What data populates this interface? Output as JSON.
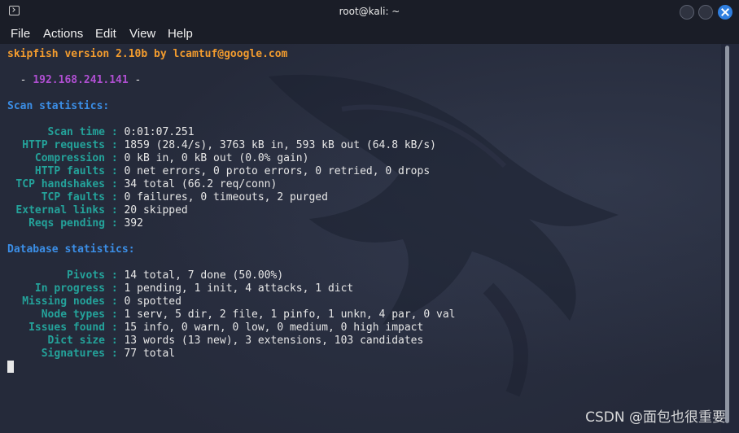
{
  "window": {
    "title": "root@kali: ~"
  },
  "menu": {
    "items": [
      "File",
      "Actions",
      "Edit",
      "View",
      "Help"
    ]
  },
  "terminal": {
    "banner": "skipfish version 2.10b by lcamtuf@google.com",
    "target_prefix": "  - ",
    "target": "192.168.241.141",
    "target_suffix": " -",
    "scan_header": "Scan statistics:",
    "scan_stats": [
      {
        "label": "Scan time",
        "value": "0:01:07.251"
      },
      {
        "label": "HTTP requests",
        "value": "1859 (28.4/s), 3763 kB in, 593 kB out (64.8 kB/s)"
      },
      {
        "label": "Compression",
        "value": "0 kB in, 0 kB out (0.0% gain)"
      },
      {
        "label": "HTTP faults",
        "value": "0 net errors, 0 proto errors, 0 retried, 0 drops"
      },
      {
        "label": "TCP handshakes",
        "value": "34 total (66.2 req/conn)"
      },
      {
        "label": "TCP faults",
        "value": "0 failures, 0 timeouts, 2 purged"
      },
      {
        "label": "External links",
        "value": "20 skipped"
      },
      {
        "label": "Reqs pending",
        "value": "392"
      }
    ],
    "db_header": "Database statistics:",
    "db_stats": [
      {
        "label": "Pivots",
        "value": "14 total, 7 done (50.00%)"
      },
      {
        "label": "In progress",
        "value": "1 pending, 1 init, 4 attacks, 1 dict"
      },
      {
        "label": "Missing nodes",
        "value": "0 spotted"
      },
      {
        "label": "Node types",
        "value": "1 serv, 5 dir, 2 file, 1 pinfo, 1 unkn, 4 par, 0 val"
      },
      {
        "label": "Issues found",
        "value": "15 info, 0 warn, 0 low, 0 medium, 0 high impact"
      },
      {
        "label": "Dict size",
        "value": "13 words (13 new), 3 extensions, 103 candidates"
      },
      {
        "label": "Signatures",
        "value": "77 total"
      }
    ],
    "separator": " : "
  },
  "watermark": "CSDN @面包也很重要",
  "colors": {
    "banner": "#f39c2e",
    "target": "#b04fd2",
    "section_header": "#3b8ee6",
    "stat_label": "#24a29a",
    "text": "#e6e6e6",
    "close_button": "#2f7fe0"
  },
  "icons": {
    "app": "terminal-icon",
    "minimize": "minimize-icon",
    "maximize": "maximize-icon",
    "close": "close-icon"
  }
}
